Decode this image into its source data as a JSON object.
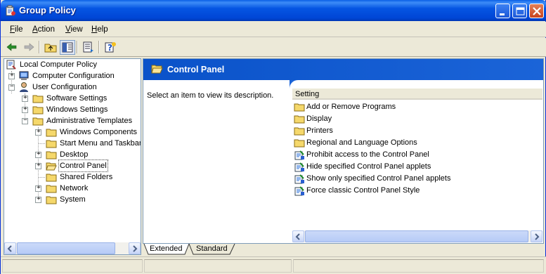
{
  "window": {
    "title": "Group Policy",
    "icon": "group-policy-icon",
    "controls": [
      "minimize-icon",
      "maximize-icon",
      "close-icon"
    ]
  },
  "menu": {
    "file": {
      "underline": "F",
      "rest": "ile"
    },
    "action": {
      "underline": "A",
      "rest": "ction"
    },
    "view": {
      "underline": "V",
      "rest": "iew"
    },
    "help": {
      "underline": "H",
      "rest": "elp"
    }
  },
  "toolbar": {
    "buttons": [
      "back-arrow-icon",
      "forward-arrow-icon",
      "up-folder-icon",
      "show-hide-tree-icon",
      "export-list-icon",
      "help-icon"
    ]
  },
  "tree": {
    "root": "Local Computer Policy",
    "computer_config": "Computer Configuration",
    "user_config": "User Configuration",
    "software_settings": "Software Settings",
    "windows_settings": "Windows Settings",
    "admin_templates": "Administrative Templates",
    "windows_components": "Windows Components",
    "start_menu": "Start Menu and Taskbar",
    "desktop": "Desktop",
    "control_panel": "Control Panel",
    "shared_folders": "Shared Folders",
    "network": "Network",
    "system": "System"
  },
  "details": {
    "header_title": "Control Panel",
    "description": "Select an item to view its description.",
    "column_header": "Setting",
    "items": [
      {
        "label": "Add or Remove Programs",
        "icon": "folder-icon"
      },
      {
        "label": "Display",
        "icon": "folder-icon"
      },
      {
        "label": "Printers",
        "icon": "folder-icon"
      },
      {
        "label": "Regional and Language Options",
        "icon": "folder-icon"
      },
      {
        "label": "Prohibit access to the Control Panel",
        "icon": "policy-setting-icon"
      },
      {
        "label": "Hide specified Control Panel applets",
        "icon": "policy-setting-icon"
      },
      {
        "label": "Show only specified Control Panel applets",
        "icon": "policy-setting-icon"
      },
      {
        "label": "Force classic Control Panel Style",
        "icon": "policy-setting-icon"
      }
    ]
  },
  "tabs": {
    "extended": "Extended",
    "standard": "Standard",
    "active": "Extended"
  },
  "colors": {
    "titlebar": "#0055e5",
    "header_blue": "#0a52c9",
    "folder_yellow": "#f5d86b"
  }
}
